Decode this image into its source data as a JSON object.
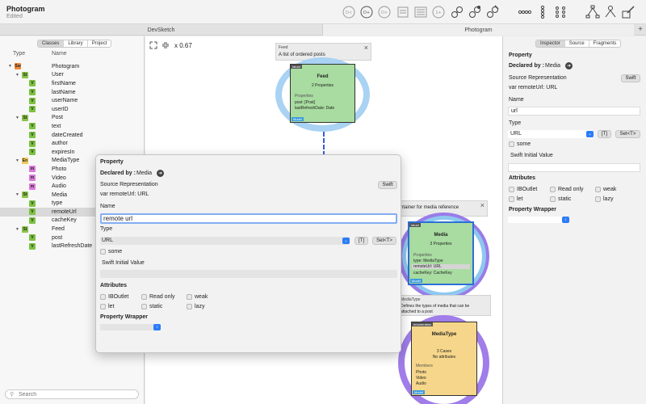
{
  "titlebar": {
    "title": "Photogram",
    "subtitle": "Edited"
  },
  "toolbar": {
    "icons": [
      "dependency-a-icon",
      "dependency-plus-icon",
      "dependency-b-icon",
      "text-layout-icon",
      "list-layout-icon",
      "stepper-icon",
      "link-icon",
      "link-settings-icon",
      "link-edit-icon",
      "horizontal-dots-icon",
      "vertical-dots-icon",
      "grid-dots-icon",
      "tree-layout-icon",
      "node-layout-icon",
      "edit-layout-icon"
    ]
  },
  "tabs": {
    "left": "DevSketch",
    "right": "Photogram",
    "add": "+"
  },
  "left": {
    "segments": [
      "Classes",
      "Library",
      "Project"
    ],
    "col_type": "Type",
    "col_name": "Name",
    "search_placeholder": "Search",
    "tree": [
      {
        "badge": "Sw",
        "kind": "swift",
        "name": "Photogram",
        "level": 0,
        "disclosure": true
      },
      {
        "badge": "St",
        "kind": "struct",
        "name": "User",
        "level": 1,
        "disclosure": true
      },
      {
        "badge": "V",
        "kind": "var",
        "name": "firstName",
        "level": 2
      },
      {
        "badge": "V",
        "kind": "var",
        "name": "lastName",
        "level": 2
      },
      {
        "badge": "V",
        "kind": "var",
        "name": "userName",
        "level": 2
      },
      {
        "badge": "V",
        "kind": "var",
        "name": "userID",
        "level": 2
      },
      {
        "badge": "St",
        "kind": "struct",
        "name": "Post",
        "level": 1,
        "disclosure": true
      },
      {
        "badge": "V",
        "kind": "var",
        "name": "text",
        "level": 2
      },
      {
        "badge": "V",
        "kind": "var",
        "name": "dateCreated",
        "level": 2
      },
      {
        "badge": "V",
        "kind": "var",
        "name": "author",
        "level": 2
      },
      {
        "badge": "V",
        "kind": "var",
        "name": "expiresIn",
        "level": 2
      },
      {
        "badge": "En",
        "kind": "enum",
        "name": "MediaType",
        "level": 1,
        "disclosure": true
      },
      {
        "badge": "m",
        "kind": "case",
        "name": "Photo",
        "level": 2
      },
      {
        "badge": "m",
        "kind": "case",
        "name": "Video",
        "level": 2
      },
      {
        "badge": "m",
        "kind": "case",
        "name": "Audio",
        "level": 2
      },
      {
        "badge": "St",
        "kind": "struct",
        "name": "Media",
        "level": 1,
        "disclosure": true
      },
      {
        "badge": "V",
        "kind": "var",
        "name": "type",
        "level": 2
      },
      {
        "badge": "V",
        "kind": "var",
        "name": "remoteUrl",
        "level": 2,
        "selected": true
      },
      {
        "badge": "V",
        "kind": "var",
        "name": "cacheKey",
        "level": 2
      },
      {
        "badge": "St",
        "kind": "struct",
        "name": "Feed",
        "level": 1,
        "disclosure": true
      },
      {
        "badge": "V",
        "kind": "var",
        "name": "post",
        "level": 2
      },
      {
        "badge": "V",
        "kind": "var",
        "name": "lastRefreshDate",
        "level": 2
      }
    ],
    "badge_colors": {
      "swift": "#f08a3c",
      "struct": "#8bc34a",
      "var": "#7cc242",
      "enum": "#f1c85a",
      "case": "#d97ad9"
    }
  },
  "canvas": {
    "zoom": "x 0.67",
    "feed_comment": {
      "title": "Feed",
      "text": "A list of ordered posts"
    },
    "feed_entity": {
      "tag": "struct",
      "title": "Feed",
      "subtitle": "2 Properties",
      "section": "Properties",
      "lines": [
        "post: [Post]",
        "lastRefreshDate: Date"
      ],
      "model": "Model"
    },
    "media_comment": {
      "text": "ntainer for media reference"
    },
    "media_entity": {
      "tag": "struct",
      "title": "Media",
      "subtitle": "3 Properties",
      "section": "Properties",
      "lines": [
        "type: MediaType",
        "remoteUrl: URL",
        "cacheKey: CacheKey"
      ],
      "model": "Model"
    },
    "mediatype_comment": {
      "title": "MediaType",
      "text1": "Defines the types of media that can be",
      "text2": "attached to a post"
    },
    "mediatype_entity": {
      "tag": "enumeration",
      "title": "MediaType",
      "subtitle": "3 Cases",
      "subtitle2": "No attributes",
      "section": "Members",
      "lines": [
        "Photo",
        "Video",
        "Audio"
      ],
      "model": "Model"
    },
    "colors": {
      "feed_ring": "#a9d2f3",
      "feed_fill": "#a8dca0",
      "media_ring": "#9a7be8",
      "media_inner_ring": "#8ec8f0",
      "media_fill": "#a8dca0",
      "media_border": "#2d6fd6",
      "mediatype_ring": "#a07de9",
      "mediatype_fill": "#f6d68a",
      "connector": "#3b5bd6"
    }
  },
  "popover": {
    "heading": "Property",
    "declared_label": "Declared by :",
    "declared_value": "Media",
    "source_label": "Source Representation",
    "swift_button": "Swift",
    "source_value": "var remoteUrl: URL",
    "name_label": "Name",
    "name_value": "remote url",
    "type_label": "Type",
    "type_value": "URL",
    "array_button": "[T]",
    "set_button": "Set<T>",
    "some_label": "some",
    "initial_label": "Swift Initial Value",
    "attributes_label": "Attributes",
    "attributes": [
      "IBOutlet",
      "Read only",
      "weak",
      "let",
      "static",
      "lazy"
    ],
    "wrapper_label": "Property Wrapper"
  },
  "inspector": {
    "segments": [
      "Inspector",
      "Source",
      "Fragments"
    ],
    "heading": "Property",
    "declared_label": "Declared by :",
    "declared_value": "Media",
    "source_label": "Source Representation",
    "swift_button": "Swift",
    "source_value": "var remoteUrl: URL",
    "name_label": "Name",
    "name_value": "url",
    "type_label": "Type",
    "type_value": "URL",
    "array_button": "[T]",
    "set_button": "Set<T>",
    "some_label": "some",
    "initial_label": "Swift Initial Value",
    "attributes_label": "Attributes",
    "attributes": [
      "IBOutlet",
      "Read only",
      "weak",
      "let",
      "static",
      "lazy"
    ],
    "wrapper_label": "Property Wrapper"
  }
}
